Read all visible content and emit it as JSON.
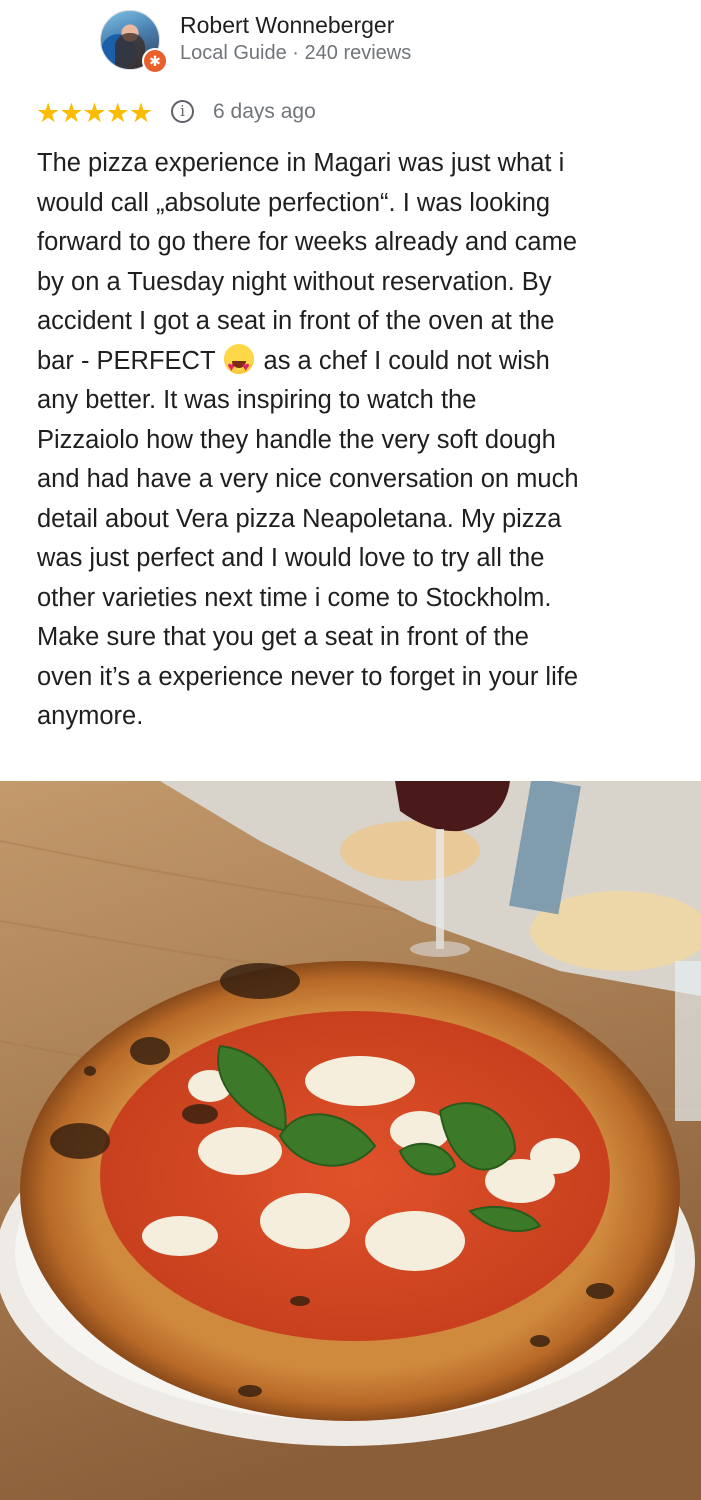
{
  "author": {
    "name": "Robert Wonneberger",
    "meta": "Local Guide · 240 reviews",
    "badge_icon": "local-guide-star-icon"
  },
  "review": {
    "stars": "★★★★★",
    "rating": 5,
    "date": "6 days ago",
    "info_icon": "i",
    "lines": [
      "The pizza experience in Magari was just what i",
      "would call „absolute perfection“. I was looking",
      "forward to go there for weeks already and came",
      "by on a Tuesday night without reservation. By",
      "accident I got a seat in front of the oven at the",
      "bar - PERFECT",
      "as a chef I could not wish",
      "any better. It was inspiring to watch the",
      "Pizzaiolo how they handle the very soft dough",
      "and had have a very nice conversation on much",
      "detail about Vera pizza Neapoletana. My pizza",
      "was just perfect and I would love to try all the",
      "other varieties next time i come to Stockholm.",
      "Make sure that you get a seat in front of the",
      "oven it’s a experience never to forget in your life",
      "anymore."
    ],
    "emoji_icon": "heart-eyes-emoji-icon"
  },
  "photo": {
    "subject": "pizza-photo"
  },
  "colors": {
    "star": "#fbbc04",
    "badge": "#e8612c",
    "meta_text": "#70757a"
  }
}
